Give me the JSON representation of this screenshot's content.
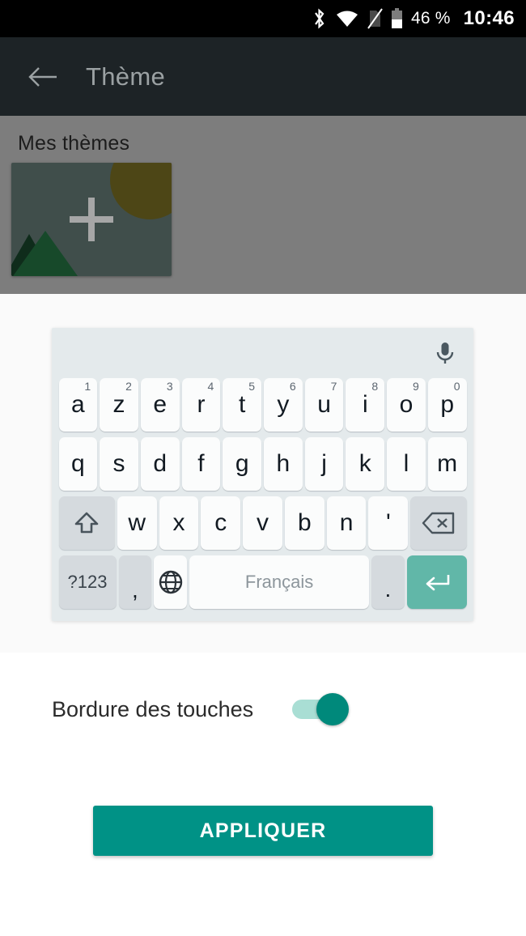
{
  "status_bar": {
    "icons": [
      "bluetooth-icon",
      "wifi-icon",
      "sim-off-icon",
      "battery-icon"
    ],
    "battery_percent": "46 %",
    "time": "10:46"
  },
  "app_bar": {
    "back_icon": "back-arrow-icon",
    "title": "Thème"
  },
  "themes": {
    "section_title": "Mes thèmes",
    "add_card": {
      "icon": "plus-icon",
      "label": ""
    }
  },
  "keyboard": {
    "mic_icon": "microphone-icon",
    "rows": [
      [
        {
          "label": "a",
          "sup": "1"
        },
        {
          "label": "z",
          "sup": "2"
        },
        {
          "label": "e",
          "sup": "3"
        },
        {
          "label": "r",
          "sup": "4"
        },
        {
          "label": "t",
          "sup": "5"
        },
        {
          "label": "y",
          "sup": "6"
        },
        {
          "label": "u",
          "sup": "7"
        },
        {
          "label": "i",
          "sup": "8"
        },
        {
          "label": "o",
          "sup": "9"
        },
        {
          "label": "p",
          "sup": "0"
        }
      ],
      [
        {
          "label": "q"
        },
        {
          "label": "s"
        },
        {
          "label": "d"
        },
        {
          "label": "f"
        },
        {
          "label": "g"
        },
        {
          "label": "h"
        },
        {
          "label": "j"
        },
        {
          "label": "k"
        },
        {
          "label": "l"
        },
        {
          "label": "m"
        }
      ],
      [
        {
          "label": "",
          "icon": "shift-icon"
        },
        {
          "label": "w"
        },
        {
          "label": "x"
        },
        {
          "label": "c"
        },
        {
          "label": "v"
        },
        {
          "label": "b"
        },
        {
          "label": "n"
        },
        {
          "label": "'"
        },
        {
          "label": "",
          "icon": "backspace-icon"
        }
      ],
      [
        {
          "label": "?123"
        },
        {
          "label": ","
        },
        {
          "label": "",
          "icon": "globe-icon"
        },
        {
          "label": "Français"
        },
        {
          "label": "."
        },
        {
          "label": "",
          "icon": "enter-icon"
        }
      ]
    ],
    "space_label": "Français",
    "symbols_label": "?123"
  },
  "settings": {
    "key_border_label": "Bordure des touches",
    "key_border_enabled": true
  },
  "actions": {
    "apply_label": "APPLIQUER"
  },
  "colors": {
    "accent": "#009286",
    "enter_key": "#61b7a8",
    "toggle_on": "#00897b",
    "app_bar": "#1d2326",
    "keyboard_bg": "#e4eaec",
    "overlay": "#7d7d7d"
  }
}
